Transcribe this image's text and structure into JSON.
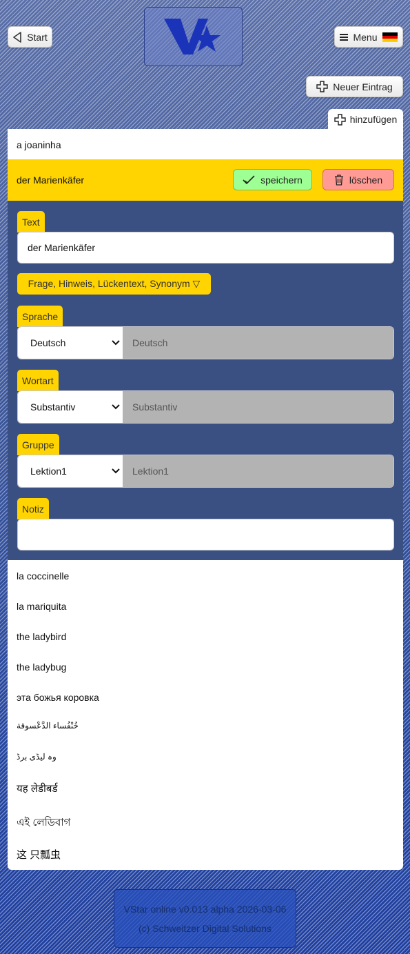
{
  "header": {
    "start_label": "Start",
    "menu_label": "Menu",
    "new_entry_label": "Neuer Eintrag",
    "add_label": "hinzufügen",
    "logo_text": "VStar"
  },
  "entries": {
    "first": "a joaninha",
    "selected": "der Marienkäfer",
    "rest": [
      "la coccinelle",
      "la mariquita",
      "the ladybird",
      "the ladybug",
      "эта божья коровка",
      "خُنْفُساء الدَّعْسوقة",
      "وہ لیڈی برڈ",
      "यह लेडीबर्ड",
      "এই লেডিবাগ",
      "这 只瓢虫"
    ]
  },
  "actions": {
    "save_label": "speichern",
    "delete_label": "löschen"
  },
  "editor": {
    "text_label": "Text",
    "text_value": "der Marienkäfer",
    "extra_toggle": "Frage, Hinweis, Lückentext, Synonym ▽",
    "language_label": "Sprache",
    "language_selected": "Deutsch",
    "language_value": "Deutsch",
    "wordtype_label": "Wortart",
    "wordtype_selected": "Substantiv",
    "wordtype_value": "Substantiv",
    "group_label": "Gruppe",
    "group_selected": "Lektion1",
    "group_value": "Lektion1",
    "note_label": "Notiz",
    "note_value": ""
  },
  "footer": {
    "version": "VStar online v0.013 alpha 2026-03-06",
    "copyright": "(c) Schweitzer Digital Solutions"
  },
  "icons": {
    "start": "back-triangle-icon",
    "menu": "hamburger-icon",
    "flag": "german-flag-icon",
    "new_entry": "plus-outline-icon",
    "save": "check-icon",
    "delete": "trash-icon",
    "dropdown": "chevron-down-icon"
  },
  "colors": {
    "selected_row": "#ffd400",
    "save": "#9dff94",
    "delete": "#ff9a95",
    "editor_bg": "#3a4f82"
  }
}
